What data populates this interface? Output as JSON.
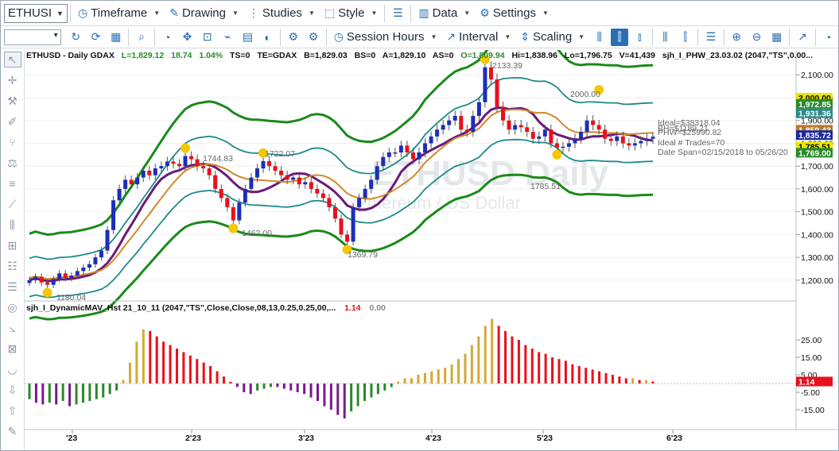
{
  "toolbar1": {
    "symbol": "ETHUSI",
    "menus": [
      {
        "label": "Timeframe",
        "icon": "timeframe-icon",
        "glyph": "◷"
      },
      {
        "label": "Drawing",
        "icon": "drawing-icon",
        "glyph": "✎"
      },
      {
        "label": "Studies",
        "icon": "studies-icon",
        "glyph": "⋮"
      },
      {
        "label": "Style",
        "icon": "style-icon",
        "glyph": "⬚"
      }
    ],
    "menus2": [
      {
        "label": "Data",
        "icon": "data-icon",
        "glyph": "▥"
      },
      {
        "label": "Settings",
        "icon": "settings-icon",
        "glyph": "⚙"
      }
    ]
  },
  "toolbar2": {
    "session_label": "Session Hours",
    "interval_label": "Interval",
    "scaling_label": "Scaling"
  },
  "header": {
    "symbol_line": "ETHUSD - Daily  GDAX",
    "L": "L=1,829.12",
    "chg": "18.74",
    "pct": "1.04%",
    "ts": "TS=0",
    "te": "TE=GDAX",
    "b": "B=1,829.03",
    "bs": "BS=0",
    "a": "A=1,829.10",
    "as": "AS=0",
    "o": "O=1,809.94",
    "hi": "Hi=1,838.96",
    "lo": "Lo=1,796.75",
    "v": "V=41,439",
    "study": "sjh_I_PHW_23.03.02 (2047,\"TS\",0.00..."
  },
  "watermark": {
    "line1": "ETHUSD Daily",
    "line2": "Ethereum / US Dollar"
  },
  "annotations": {
    "p2133": "2133.39",
    "p2000": "2000.00",
    "p1744": "1744.83",
    "p1722": "1722.07",
    "p1462": "1462.00",
    "p1369": "1369.79",
    "p1180": "1180.04",
    "p1785": "1785.51",
    "ideal": "Ideal=$38318.04",
    "bh": "BH=$1189.21",
    "phw": "PHW=$25990.82",
    "trades": "Ideal # Trades=70",
    "span": "Date Span=02/15/2018 to 05/26/20"
  },
  "price_axis": {
    "ticks": [
      "2,100.00",
      "2,000.00",
      "1,900.00",
      "1,800.00",
      "1,700.00",
      "1,600.00",
      "1,500.00",
      "1,400.00",
      "1,300.00",
      "1,200.00"
    ],
    "badges": [
      {
        "text": "2,000.00",
        "bg": "#e8e800",
        "fg": "#000"
      },
      {
        "text": "1,972.85",
        "bg": "#2a8a2a",
        "fg": "#fff"
      },
      {
        "text": "1,931.36",
        "bg": "#2a8a8a",
        "fg": "#fff"
      },
      {
        "text": "1,859.43",
        "bg": "#b87a28",
        "fg": "#fff"
      },
      {
        "text": "1,835.72",
        "bg": "#1c2a9c",
        "fg": "#fff"
      },
      {
        "text": "1,785.51",
        "bg": "#e8e800",
        "fg": "#000"
      },
      {
        "text": "1,769.00",
        "bg": "#2a8a2a",
        "fg": "#fff"
      }
    ]
  },
  "indicator": {
    "title": "sjh_I_DynamicMAV_Hst 21_10_11 (2047,\"TS\",Close,Close,08,13,0.25,0.25,00,...",
    "v1": "1.14",
    "v2": "0.00",
    "ticks": [
      "25.00",
      "15.00",
      "5.00",
      "-5.00",
      "-15.00"
    ],
    "badge": "1.14"
  },
  "time_axis": [
    "'23",
    "2'23",
    "3'23",
    "4'23",
    "5'23",
    "6'23"
  ],
  "colors": {
    "up": "#1c2fb8",
    "down": "#e8101c",
    "band_outer": "#1a8a1a",
    "band_inner": "#1d8a8a",
    "ma1": "#6a1a78",
    "ma2": "#d08a28",
    "swing": "#f5c800",
    "hist_gold": "#d4a838",
    "hist_red": "#e8101c",
    "hist_purple": "#7a1a8a",
    "hist_green": "#2a8a2a"
  },
  "chart_data": {
    "type": "candlestick",
    "closes": [
      1200,
      1215,
      1190,
      1180,
      1205,
      1230,
      1210,
      1220,
      1240,
      1255,
      1270,
      1300,
      1330,
      1420,
      1550,
      1600,
      1640,
      1620,
      1650,
      1680,
      1660,
      1690,
      1700,
      1720,
      1710,
      1700,
      1744,
      1730,
      1700,
      1690,
      1660,
      1600,
      1560,
      1520,
      1462,
      1540,
      1600,
      1650,
      1690,
      1722,
      1700,
      1680,
      1660,
      1640,
      1650,
      1620,
      1630,
      1600,
      1580,
      1560,
      1520,
      1470,
      1400,
      1369,
      1520,
      1560,
      1600,
      1640,
      1700,
      1740,
      1760,
      1760,
      1790,
      1760,
      1730,
      1760,
      1800,
      1830,
      1860,
      1880,
      1900,
      1920,
      1860,
      1850,
      1920,
      1980,
      2133,
      2080,
      1960,
      1900,
      1860,
      1880,
      1870,
      1850,
      1820,
      1830,
      1860,
      1800,
      1780,
      1785,
      1800,
      1820,
      1850,
      1900,
      1880,
      1860,
      1820,
      1810,
      1830,
      1800,
      1790,
      1800,
      1810,
      1820,
      1829
    ],
    "histogram": [
      -9,
      -11,
      -12,
      -11,
      -12,
      -10,
      -13,
      -12,
      -11,
      -10,
      -9,
      -8,
      -6,
      -4,
      2,
      12,
      24,
      31,
      30,
      27,
      24,
      22,
      20,
      18,
      16,
      14,
      12,
      10,
      7,
      4,
      1,
      -2,
      -5,
      -6,
      -4,
      -3,
      -2,
      -2,
      -3,
      -4,
      -5,
      -6,
      -8,
      -10,
      -13,
      -15,
      -18,
      -20,
      -16,
      -13,
      -10,
      -8,
      -6,
      -4,
      -2,
      1,
      3,
      3,
      5,
      6,
      7,
      8,
      9,
      11,
      14,
      17,
      22,
      27,
      33,
      37,
      33,
      30,
      27,
      25,
      22,
      20,
      18,
      17,
      15,
      14,
      13,
      11,
      10,
      9,
      8,
      7,
      6,
      5,
      4,
      3,
      3,
      2,
      2,
      1.14
    ],
    "price_range": [
      1130,
      2160
    ]
  }
}
